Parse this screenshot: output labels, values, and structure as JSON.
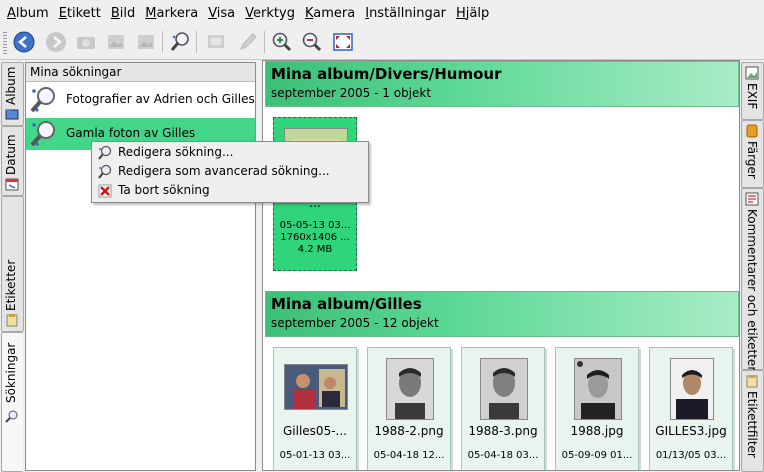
{
  "menubar": {
    "items": [
      "Album",
      "Etikett",
      "Bild",
      "Markera",
      "Visa",
      "Verktyg",
      "Kamera",
      "Inställningar",
      "Hjälp"
    ]
  },
  "toolbar": {
    "icons": [
      "back-icon",
      "forward-icon",
      "camera-icon",
      "image-icon",
      "image-icon",
      "search-icon",
      "slideshow-icon",
      "edit-icon",
      "zoom-in-icon",
      "zoom-out-icon",
      "fullscreen-icon"
    ]
  },
  "left_tabs": {
    "album": "Album",
    "datum": "Datum",
    "etiketter": "Etiketter",
    "sokningar": "Sökningar"
  },
  "right_tabs": {
    "exif": "EXIF",
    "farger": "Färger",
    "kommentarer": "Kommentarer och etiketter",
    "etikettfilter": "Etikettfilter"
  },
  "searches": {
    "header": "Mina sökningar",
    "items": [
      {
        "label": "Fotografier av Adrien och Gilles"
      },
      {
        "label": "Gamla foton av Gilles"
      }
    ]
  },
  "context_menu": {
    "items": [
      {
        "label": "Redigera sökning..."
      },
      {
        "label": "Redigera som avancerad sökning..."
      },
      {
        "label": "Ta bort sökning"
      }
    ]
  },
  "groups": [
    {
      "title": "Mina album/Divers/Humour",
      "subtitle": "september 2005 - 1 objekt",
      "items": [
        {
          "name": "...",
          "meta1": "05-05-13 03...",
          "meta2": "1760x1406 ...",
          "meta3": "4.2 MB"
        }
      ]
    },
    {
      "title": "Mina album/Gilles",
      "subtitle": "september 2005 - 12 objekt",
      "items": [
        {
          "name": "Gilles05-...",
          "meta1": "05-01-13 03..."
        },
        {
          "name": "1988-2.png",
          "meta1": "05-04-18 12..."
        },
        {
          "name": "1988-3.png",
          "meta1": "05-04-18 03..."
        },
        {
          "name": "1988.jpg",
          "meta1": "05-09-09 01..."
        },
        {
          "name": "GILLES3.jpg",
          "meta1": "01/13/05 03..."
        }
      ]
    }
  ],
  "colors": {
    "selection": "#43d689",
    "group_header": "#5cd896"
  }
}
